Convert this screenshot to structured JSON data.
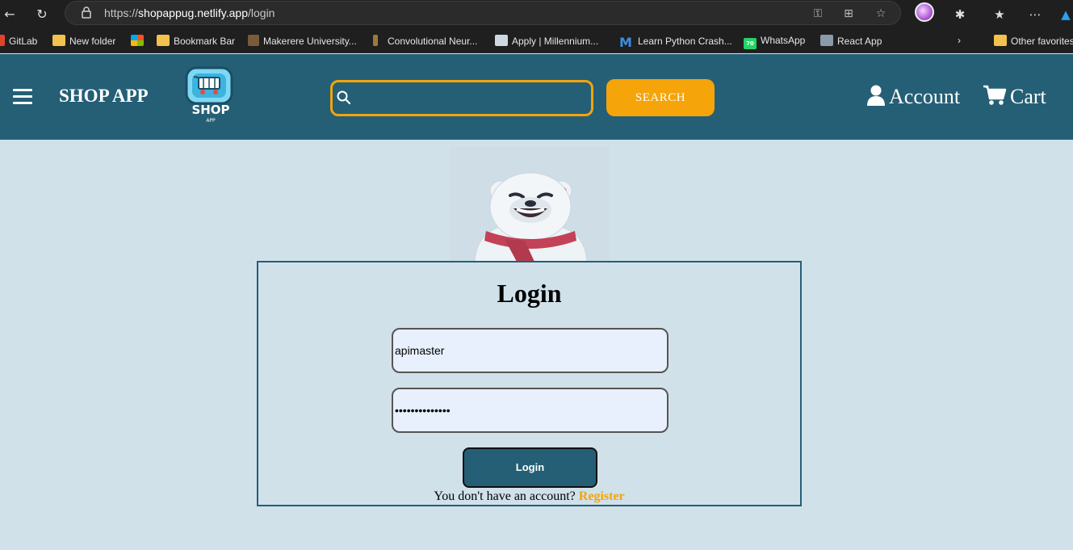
{
  "browser": {
    "url_prefix": "https://",
    "url_host": "shopappug.netlify.app",
    "url_path": "/login",
    "bookmarks": [
      {
        "label": "GitLab",
        "icon": "gitlab-icon"
      },
      {
        "label": "New folder",
        "icon": "folder-icon"
      },
      {
        "label": "",
        "icon": "microsoft-icon"
      },
      {
        "label": "Bookmark Bar",
        "icon": "folder-icon"
      },
      {
        "label": "Makerere University...",
        "icon": "makerere-icon"
      },
      {
        "label": "Convolutional Neur...",
        "icon": "bookmark-site-icon"
      },
      {
        "label": "Apply | Millennium...",
        "icon": "globe-icon"
      },
      {
        "label": "Learn Python Crash...",
        "icon": "m-logo-icon"
      },
      {
        "label": "WhatsApp",
        "icon": "whatsapp-icon"
      },
      {
        "label": "React App",
        "icon": "globe-icon"
      }
    ],
    "whatsapp_badge": "70",
    "other_favorites": "Other favorites"
  },
  "header": {
    "brand": "SHOP APP",
    "logo_text": "SHOP",
    "logo_subtext": "APP",
    "search_placeholder": "",
    "search_button": "SEARCH",
    "account_label": "Account",
    "cart_label": "Cart"
  },
  "login": {
    "title": "Login",
    "username_value": "apimaster",
    "password_value": "••••••••••••••",
    "submit_label": "Login",
    "no_account_text": "You don't have an account?",
    "register_link": "Register"
  },
  "colors": {
    "header_bg": "#245f76",
    "accent": "#f5a409",
    "page_bg": "#d1e1ea"
  }
}
